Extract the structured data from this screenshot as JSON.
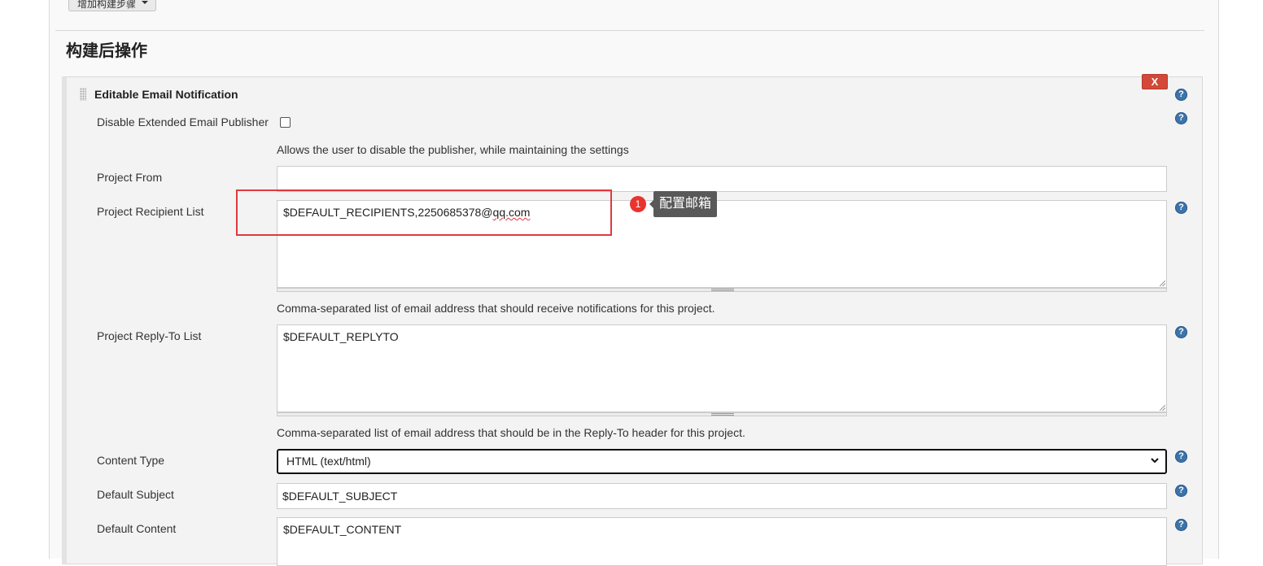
{
  "toolbar": {
    "add_build_step_label": "增加构建步骤"
  },
  "section": {
    "title": "构建后操作"
  },
  "panel": {
    "title": "Editable Email Notification",
    "delete_label": "X",
    "help_symbol": "?"
  },
  "fields": {
    "disable_publisher": {
      "label": "Disable Extended Email Publisher",
      "checked": false,
      "description": "Allows the user to disable the publisher, while maintaining the settings"
    },
    "project_from": {
      "label": "Project From",
      "value": ""
    },
    "recipient_list": {
      "label": "Project Recipient List",
      "value_prefix": "$DEFAULT_RECIPIENTS,2250685378@",
      "value_suffix": "qq.com",
      "description": "Comma-separated list of email address that should receive notifications for this project."
    },
    "reply_to_list": {
      "label": "Project Reply-To List",
      "value": "$DEFAULT_REPLYTO",
      "description": "Comma-separated list of email address that should be in the Reply-To header for this project."
    },
    "content_type": {
      "label": "Content Type",
      "selected": "HTML (text/html)"
    },
    "default_subject": {
      "label": "Default Subject",
      "value": "$DEFAULT_SUBJECT"
    },
    "default_content": {
      "label": "Default Content",
      "value": "$DEFAULT_CONTENT"
    }
  },
  "annotation": {
    "step_number": "1",
    "text": "配置邮箱",
    "color": "#e0393e"
  },
  "colors": {
    "help_icon": "#3d73a8",
    "delete_button": "#d24939",
    "panel_bg": "#f3f3f3"
  },
  "icons": {
    "help": "help-icon",
    "drag": "drag-handle-icon",
    "select_arrow": "chevron-down-icon"
  }
}
